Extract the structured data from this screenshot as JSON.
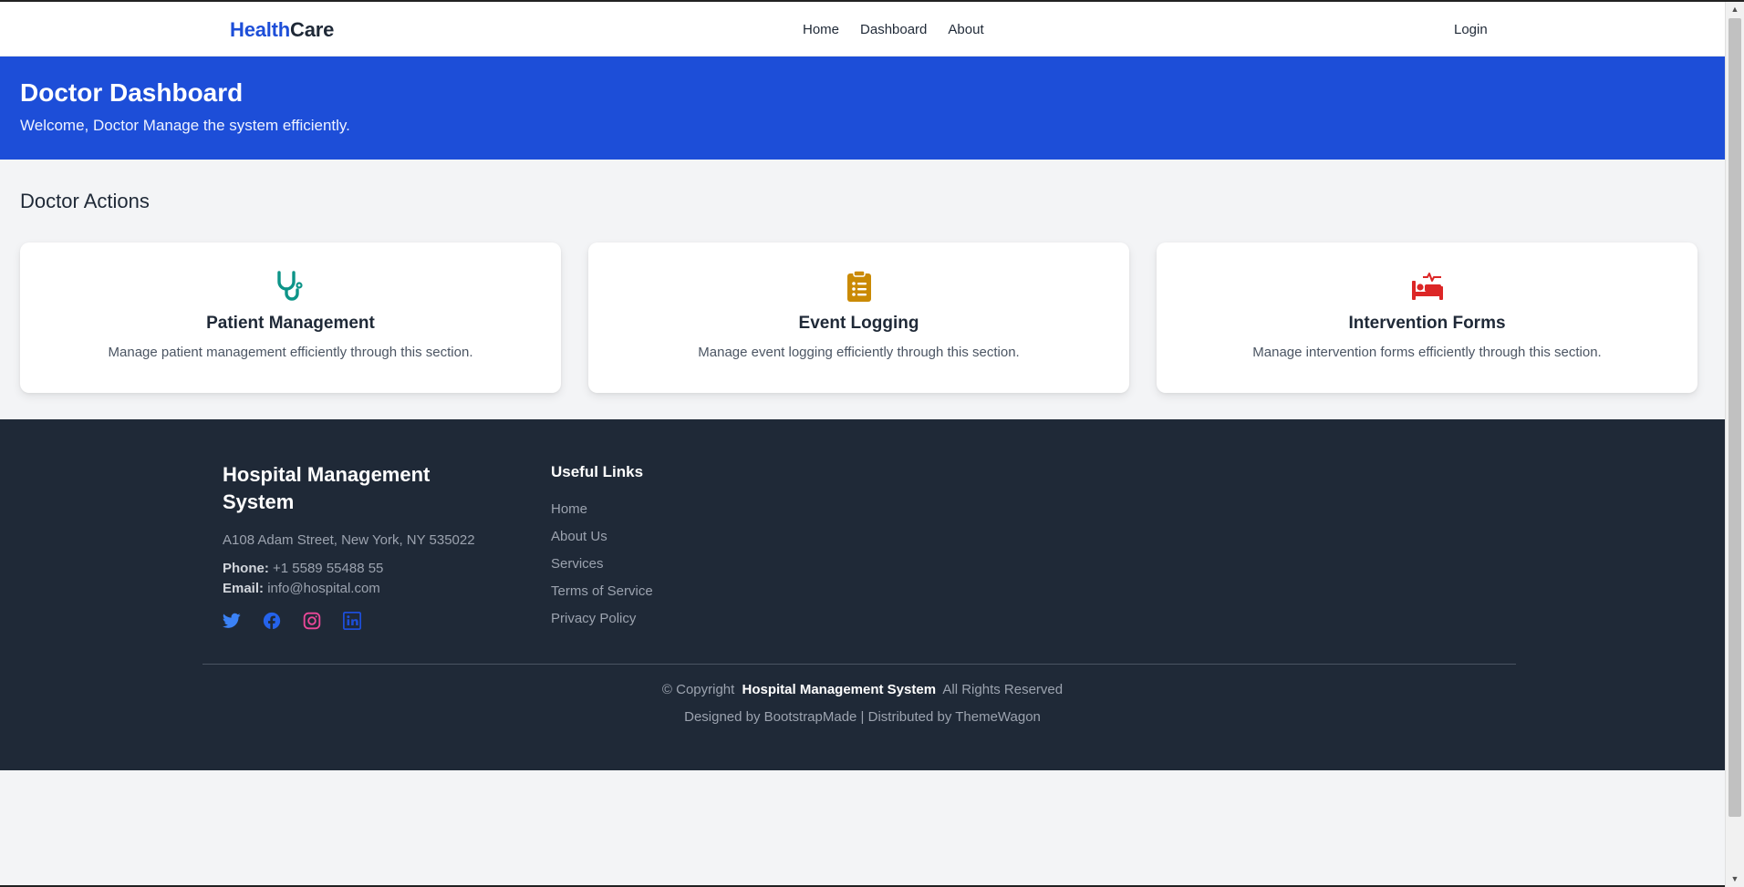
{
  "nav": {
    "brand_part1": "Health",
    "brand_part2": "Care",
    "links": [
      "Home",
      "Dashboard",
      "About"
    ],
    "login": "Login"
  },
  "hero": {
    "title": "Doctor Dashboard",
    "subtitle": "Welcome, Doctor Manage the system efficiently."
  },
  "actions": {
    "heading": "Doctor Actions",
    "cards": [
      {
        "icon": "stethoscope-icon",
        "color": "#0d9488",
        "title": "Patient Management",
        "desc": "Manage patient management efficiently through this section."
      },
      {
        "icon": "clipboard-list-icon",
        "color": "#ca8a04",
        "title": "Event Logging",
        "desc": "Manage event logging efficiently through this section."
      },
      {
        "icon": "hospital-bed-icon",
        "color": "#dc2626",
        "title": "Intervention Forms",
        "desc": "Manage intervention forms efficiently through this section."
      }
    ]
  },
  "footer": {
    "title": "Hospital Management System",
    "address": "A108 Adam Street, New York, NY 535022",
    "phone_label": "Phone:",
    "phone": "+1 5589 55488 55",
    "email_label": "Email:",
    "email": "info@hospital.com",
    "socials": [
      {
        "icon": "twitter-icon",
        "color": "#3b82f6"
      },
      {
        "icon": "facebook-icon",
        "color": "#2563eb"
      },
      {
        "icon": "instagram-icon",
        "color": "#ec4899"
      },
      {
        "icon": "linkedin-icon",
        "color": "#1d4ed8"
      }
    ],
    "links_title": "Useful Links",
    "links": [
      "Home",
      "About Us",
      "Services",
      "Terms of Service",
      "Privacy Policy"
    ],
    "copyright_prefix": "© Copyright",
    "copyright_name": "Hospital Management System",
    "copyright_suffix": "All Rights Reserved",
    "credits": "Designed by BootstrapMade | Distributed by ThemeWagon"
  },
  "colors": {
    "primary": "#1d4ed8",
    "footer_bg": "#1f2937",
    "page_bg": "#f3f4f6"
  }
}
